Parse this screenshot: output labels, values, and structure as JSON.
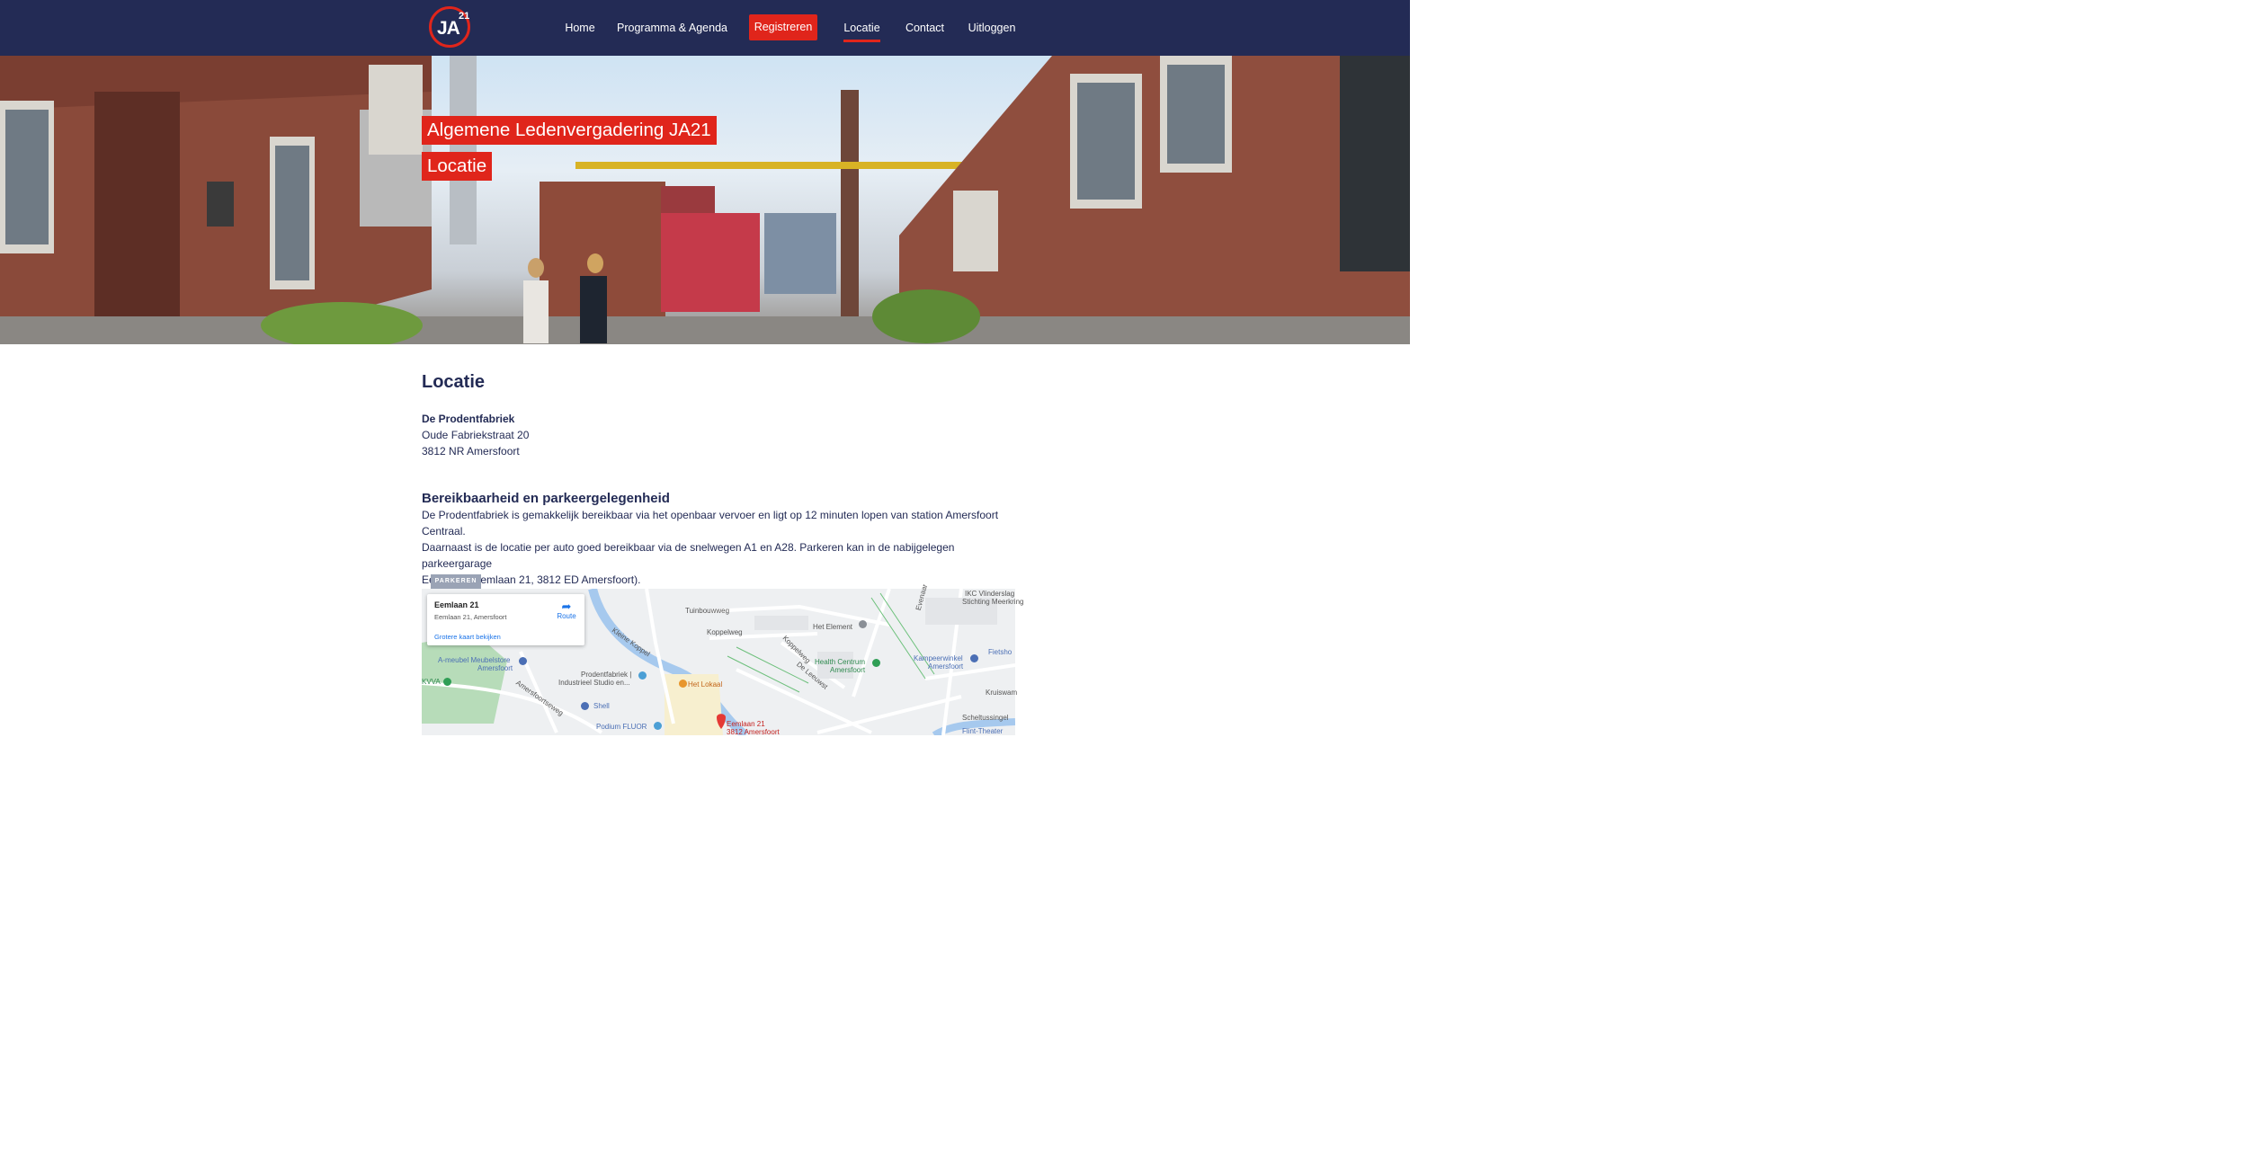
{
  "nav": {
    "logo_text": "JA",
    "logo_sup": "21",
    "items": [
      {
        "label": "Home"
      },
      {
        "label": "Programma & Agenda"
      },
      {
        "label": "Registreren"
      },
      {
        "label": "Locatie"
      },
      {
        "label": "Contact"
      },
      {
        "label": "Uitloggen"
      }
    ],
    "active": "Locatie"
  },
  "hero": {
    "title": "Algemene Ledenvergadering JA21",
    "subtitle": "Locatie"
  },
  "location": {
    "heading": "Locatie",
    "venue": "De Prodentfabriek",
    "street": "Oude Fabriekstraat 20",
    "city": "3812 NR Amersfoort"
  },
  "reach": {
    "heading": "Bereikbaarheid en parkeergelegenheid",
    "line1": "De Prodentfabriek is gemakkelijk bereikbaar via het openbaar vervoer en ligt op 12 minuten lopen van station Amersfoort Centraal.",
    "line2": "Daarnaast is de locatie per auto goed bereikbaar via de snelwegen A1 en A28. Parkeren kan in de nabijgelegen parkeergarage",
    "line3": "Eemplein (Eemlaan 21, 3812 ED Amersfoort)."
  },
  "map": {
    "badge": "PARKEREN",
    "card_title": "Eemlaan 21",
    "card_sub": "Eemlaan 21, Amersfoort",
    "card_link": "Grotere kaart bekijken",
    "route_label": "Route",
    "labels": {
      "tuinbouwweg": "Tuinbouwweg",
      "koppelweg": "Koppelweg",
      "het_element": "Het Element",
      "ikc": "IKC Vlinderslag",
      "stichting": "Stichting Meerkring",
      "kleine_koppel": "Kleine Koppel",
      "meubel": "A-meubel Meubelstore",
      "meubel2": "Amersfoort",
      "prodent1": "Prodentfabriek |",
      "prodent2": "Industrieel Studio en...",
      "het_lokaal": "Het Lokaal",
      "health1": "Health Centrum",
      "health2": "Amersfoort",
      "kampeer1": "Kampeerwinkel",
      "kampeer2": "Amersfoort",
      "fietsho": "Fietsho",
      "kvva": "KVVA",
      "amersfoortseweg": "Amersfoortseweg",
      "shell": "Shell",
      "podium": "Podium FLUOR",
      "eemlaan1": "Eemlaan 21",
      "eemlaan2": "3812 Amersfoort",
      "flint": "Flint-Theater",
      "kruiswam": "Kruiswam",
      "scheltussingel": "Scheltussingel",
      "de_leeuwstraat": "De Leeuwst",
      "koppelweg2": "Koppelweg",
      "everest": "Evenaar"
    }
  },
  "colors": {
    "navy": "#232b55",
    "red": "#e0251b"
  }
}
